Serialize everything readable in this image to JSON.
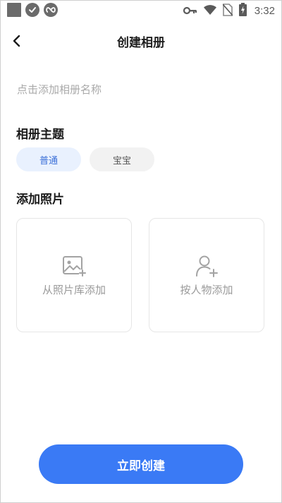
{
  "status_bar": {
    "time": "3:32",
    "left_icons": [
      "app-square-icon",
      "shield-check-icon",
      "infinity-icon"
    ],
    "right_icons": [
      "key-icon",
      "wifi-icon",
      "no-sim-icon",
      "battery-charging-icon"
    ]
  },
  "header": {
    "title": "创建相册",
    "back_icon": "chevron-left-icon"
  },
  "name_input": {
    "placeholder": "点击添加相册名称",
    "value": ""
  },
  "theme_section": {
    "title": "相册主题",
    "options": [
      {
        "label": "普通",
        "selected": true
      },
      {
        "label": "宝宝",
        "selected": false
      }
    ]
  },
  "photo_section": {
    "title": "添加照片",
    "cards": [
      {
        "label": "从照片库添加",
        "icon": "image-add-icon"
      },
      {
        "label": "按人物添加",
        "icon": "person-add-icon"
      }
    ]
  },
  "create_button": {
    "label": "立即创建"
  },
  "colors": {
    "accent": "#3a7af5",
    "chip_selected_bg": "#e9f1fe",
    "chip_selected_text": "#3a6fd8",
    "chip_normal_bg": "#f2f2f2",
    "placeholder_text": "#a9a9a9",
    "card_border": "#e6e6e6"
  }
}
